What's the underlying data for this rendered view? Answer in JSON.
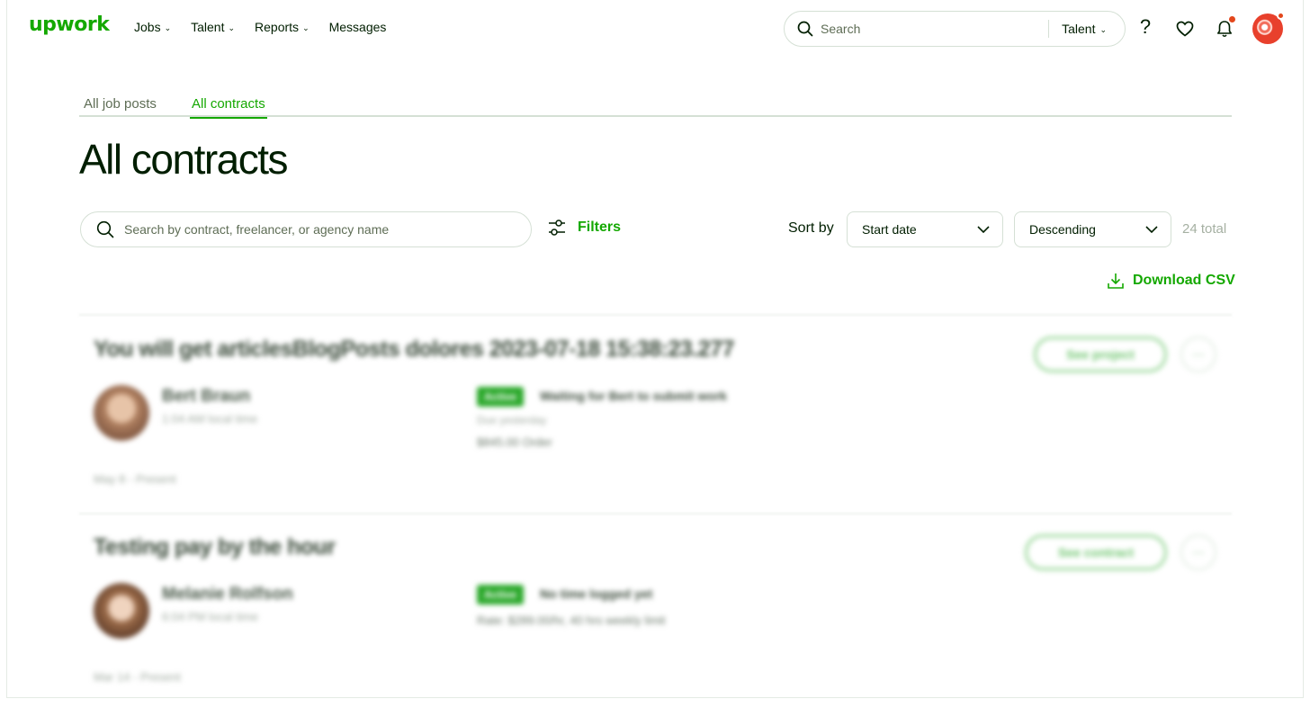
{
  "header": {
    "logo": "upwork",
    "nav": [
      {
        "label": "Jobs",
        "has_menu": true
      },
      {
        "label": "Talent",
        "has_menu": true
      },
      {
        "label": "Reports",
        "has_menu": true
      },
      {
        "label": "Messages",
        "has_menu": false
      }
    ],
    "search": {
      "placeholder": "Search",
      "scope": "Talent"
    },
    "icons": [
      "help-icon",
      "heart-icon",
      "bell-icon",
      "avatar"
    ]
  },
  "tabs": [
    {
      "label": "All job posts",
      "active": false
    },
    {
      "label": "All contracts",
      "active": true
    }
  ],
  "page_title": "All contracts",
  "toolbar": {
    "search_placeholder": "Search by contract, freelancer, or agency name",
    "filters_label": "Filters",
    "sort_label": "Sort by",
    "sort_field": "Start date",
    "sort_order": "Descending",
    "total": "24 total",
    "download_label": "Download CSV"
  },
  "contracts": [
    {
      "title": "You will get articlesBlogPosts dolores 2023-07-18 15:38:23.277",
      "freelancer": "Bert Braun",
      "local_time": "1:04 AM local time",
      "status": "Active",
      "status_text": "Waiting for Bert to submit work",
      "sub1": "Due yesterday",
      "sub2": "$845.00 Order",
      "dates": "May 8 - Present",
      "action": "See project"
    },
    {
      "title": "Testing pay by the hour",
      "freelancer": "Melanie Rolfson",
      "local_time": "6:04 PM local time",
      "status": "Active",
      "status_text": "No time logged yet",
      "sub1": "",
      "sub2": "Rate: $289.00/hr, 40 hrs weekly limit",
      "dates": "Mar 14 - Present",
      "action": "See contract"
    }
  ],
  "colors": {
    "brand": "#14a800",
    "text": "#001e00",
    "muted": "#5e6d55",
    "border": "#d5e0d5",
    "notification": "#e3471c"
  }
}
